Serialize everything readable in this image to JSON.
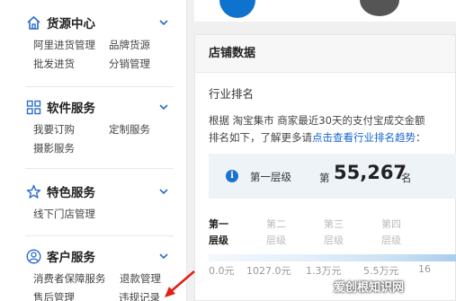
{
  "sidebar": {
    "sections": [
      {
        "title": "货源中心",
        "icon": "home-icon",
        "links": [
          "阿里进货管理",
          "品牌货源",
          "批发进货",
          "分销管理"
        ]
      },
      {
        "title": "软件服务",
        "icon": "grid-icon",
        "links": [
          "我要订购",
          "定制服务",
          "摄影服务"
        ]
      },
      {
        "title": "特色服务",
        "icon": "star-icon",
        "links": [
          "线下门店管理"
        ]
      },
      {
        "title": "客户服务",
        "icon": "user-icon",
        "links": [
          "消费者保障服务",
          "退款管理",
          "售后管理",
          "违规记录"
        ]
      }
    ]
  },
  "panel": {
    "title": "店铺数据",
    "rank_title": "行业排名",
    "desc_line1": "根据 淘宝集市 商家最近30天的支付宝成交金额",
    "desc_line2_prefix": "排名如下，了解更多请",
    "desc_line2_link": "点击查看行业排名趋势",
    "desc_line2_suffix": "：",
    "tier_label": "第一层级",
    "rank_prefix": "第",
    "rank_value": "55,267",
    "rank_suffix": "名",
    "tiers": [
      {
        "line1": "第一",
        "line2": "层级",
        "active": true
      },
      {
        "line1": "第二",
        "line2": "层级",
        "active": false
      },
      {
        "line1": "第三",
        "line2": "层级",
        "active": false
      },
      {
        "line1": "第四",
        "line2": "层级",
        "active": false
      }
    ],
    "bar_labels": [
      "0.0元",
      "1027.0元",
      "1.3万元",
      "5.5万元",
      "16"
    ]
  },
  "watermark": "爱创根知识网",
  "colors": {
    "accent": "#1a66cc",
    "annotation": "#e0201a"
  }
}
